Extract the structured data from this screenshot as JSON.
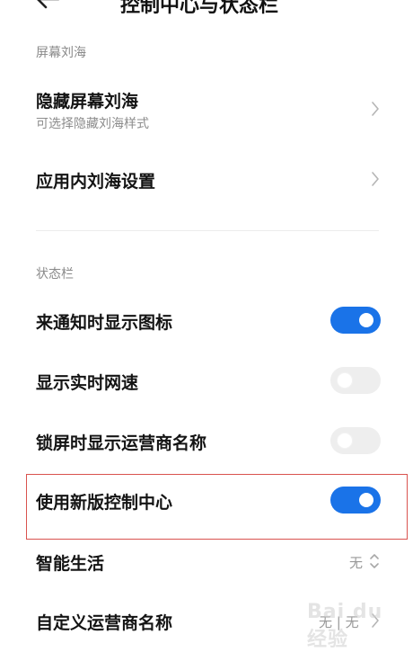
{
  "header": {
    "title": "控制中心与状态栏",
    "back_icon": "back-arrow-icon"
  },
  "sections": {
    "notch": {
      "label": "屏幕刘海",
      "hide_notch": {
        "title": "隐藏屏幕刘海",
        "subtitle": "可选择隐藏刘海样式"
      },
      "in_app_notch": {
        "title": "应用内刘海设置"
      }
    },
    "status_bar": {
      "label": "状态栏",
      "notif_icons": {
        "title": "来通知时显示图标",
        "enabled": true
      },
      "net_speed": {
        "title": "显示实时网速",
        "enabled": false
      },
      "carrier_lock": {
        "title": "锁屏时显示运营商名称",
        "enabled": false
      },
      "new_control_center": {
        "title": "使用新版控制中心",
        "enabled": true
      },
      "smart_life": {
        "title": "智能生活",
        "value": "无"
      },
      "carrier_name": {
        "title": "自定义运营商名称",
        "value": "无 | 无"
      }
    }
  },
  "watermark": {
    "text": "Bai du 经验"
  },
  "colors": {
    "toggle_on": "#1a73e8",
    "toggle_off": "#eeeeee",
    "highlight": "#d9534f"
  }
}
